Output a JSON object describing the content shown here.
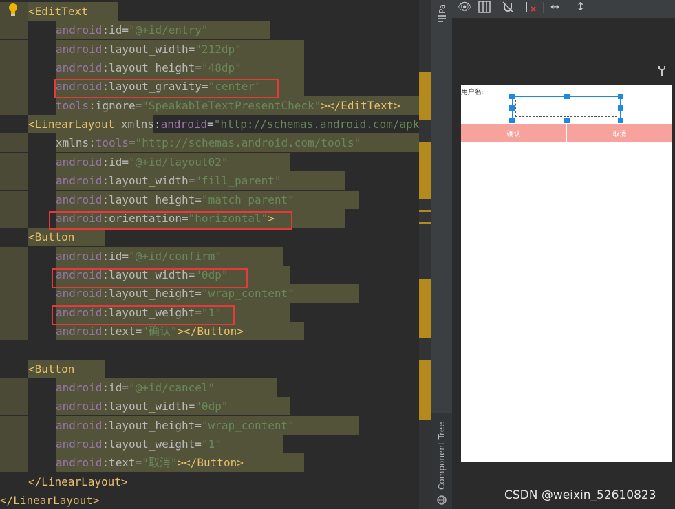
{
  "code_lines": [
    {
      "segs": [
        {
          "c": "tag",
          "t": "<EditText"
        }
      ]
    },
    {
      "segs": [
        {
          "c": "ns",
          "t": "android"
        },
        {
          "c": "attr",
          "t": ":id="
        },
        {
          "c": "str",
          "t": "\"@+id/entry\""
        }
      ]
    },
    {
      "segs": [
        {
          "c": "ns",
          "t": "android"
        },
        {
          "c": "attr",
          "t": ":layout_width="
        },
        {
          "c": "str",
          "t": "\"212dp\""
        }
      ]
    },
    {
      "segs": [
        {
          "c": "ns",
          "t": "android"
        },
        {
          "c": "attr",
          "t": ":layout_height="
        },
        {
          "c": "str",
          "t": "\"48dp\""
        }
      ]
    },
    {
      "segs": [
        {
          "c": "ns",
          "t": "android"
        },
        {
          "c": "attr",
          "t": ":layout_gravity="
        },
        {
          "c": "str",
          "t": "\"center\""
        }
      ]
    },
    {
      "segs": [
        {
          "c": "ns",
          "t": "tools"
        },
        {
          "c": "attr",
          "t": ":ignore="
        },
        {
          "c": "str",
          "t": "\"SpeakableTextPresentCheck\""
        },
        {
          "c": "tag",
          "t": "></EditText>"
        }
      ]
    },
    {
      "segs": [
        {
          "c": "tag",
          "t": "<LinearLayout "
        },
        {
          "c": "attr",
          "t": "xmlns:"
        },
        {
          "c": "ns",
          "t": "android"
        },
        {
          "c": "attr",
          "t": "="
        },
        {
          "c": "str",
          "t": "\"http://schemas.android.com/apk"
        }
      ]
    },
    {
      "segs": [
        {
          "c": "attr",
          "t": "xmlns:"
        },
        {
          "c": "ns",
          "t": "tools"
        },
        {
          "c": "attr",
          "t": "="
        },
        {
          "c": "str",
          "t": "\"http://schemas.android.com/tools\""
        }
      ]
    },
    {
      "segs": [
        {
          "c": "ns",
          "t": "android"
        },
        {
          "c": "attr",
          "t": ":id="
        },
        {
          "c": "str",
          "t": "\"@+id/layout02\""
        }
      ]
    },
    {
      "segs": [
        {
          "c": "ns",
          "t": "android"
        },
        {
          "c": "attr",
          "t": ":layout_width="
        },
        {
          "c": "str",
          "t": "\"fill_parent\""
        }
      ]
    },
    {
      "segs": [
        {
          "c": "ns",
          "t": "android"
        },
        {
          "c": "attr",
          "t": ":layout_height="
        },
        {
          "c": "str",
          "t": "\"match_parent\""
        }
      ]
    },
    {
      "segs": [
        {
          "c": "ns",
          "t": "android"
        },
        {
          "c": "attr",
          "t": ":orientation="
        },
        {
          "c": "str",
          "t": "\"horizontal\""
        },
        {
          "c": "tag",
          "t": ">"
        }
      ]
    },
    {
      "segs": [
        {
          "c": "tag",
          "t": "<Button"
        }
      ]
    },
    {
      "segs": [
        {
          "c": "ns",
          "t": "android"
        },
        {
          "c": "attr",
          "t": ":id="
        },
        {
          "c": "str",
          "t": "\"@+id/confirm\""
        }
      ]
    },
    {
      "segs": [
        {
          "c": "ns",
          "t": "android"
        },
        {
          "c": "attr",
          "t": ":layout_width="
        },
        {
          "c": "str",
          "t": "\"0dp\""
        }
      ]
    },
    {
      "segs": [
        {
          "c": "ns",
          "t": "android"
        },
        {
          "c": "attr",
          "t": ":layout_height="
        },
        {
          "c": "str",
          "t": "\"wrap_content\""
        }
      ]
    },
    {
      "segs": [
        {
          "c": "ns",
          "t": "android"
        },
        {
          "c": "attr",
          "t": ":layout_weight="
        },
        {
          "c": "str",
          "t": "\"1\""
        }
      ]
    },
    {
      "segs": [
        {
          "c": "ns",
          "t": "android"
        },
        {
          "c": "attr",
          "t": ":text="
        },
        {
          "c": "str",
          "t": "\"确认\""
        },
        {
          "c": "tag",
          "t": "></Button>"
        }
      ]
    },
    {
      "segs": []
    },
    {
      "segs": [
        {
          "c": "tag",
          "t": "<Button"
        }
      ]
    },
    {
      "segs": [
        {
          "c": "ns",
          "t": "android"
        },
        {
          "c": "attr",
          "t": ":id="
        },
        {
          "c": "str",
          "t": "\"@+id/cancel\""
        }
      ]
    },
    {
      "segs": [
        {
          "c": "ns",
          "t": "android"
        },
        {
          "c": "attr",
          "t": ":layout_width="
        },
        {
          "c": "str",
          "t": "\"0dp\""
        }
      ]
    },
    {
      "segs": [
        {
          "c": "ns",
          "t": "android"
        },
        {
          "c": "attr",
          "t": ":layout_height="
        },
        {
          "c": "str",
          "t": "\"wrap_content\""
        }
      ]
    },
    {
      "segs": [
        {
          "c": "ns",
          "t": "android"
        },
        {
          "c": "attr",
          "t": ":layout_weight="
        },
        {
          "c": "str",
          "t": "\"1\""
        }
      ]
    },
    {
      "segs": [
        {
          "c": "ns",
          "t": "android"
        },
        {
          "c": "attr",
          "t": ":text="
        },
        {
          "c": "str",
          "t": "\"取消\""
        },
        {
          "c": "tag",
          "t": "></Button>"
        }
      ]
    },
    {
      "segs": [
        {
          "c": "tag",
          "t": "</LinearLayout>"
        }
      ]
    },
    {
      "segs": [
        {
          "c": "tag",
          "t": "</LinearLayout>"
        }
      ]
    }
  ],
  "side_panel": {
    "palette_tab": "Pa",
    "component_tree_tab": "Component Tree"
  },
  "preview": {
    "label": "用户名:",
    "confirm_button": "确认",
    "cancel_button": "取消",
    "button_color": "#f8a29e"
  },
  "watermark": "CSDN @weixin_52610823",
  "colors": {
    "editor_bg": "#2b2b2b",
    "selection": "#53533a",
    "highlight_box": "#e8383b"
  }
}
